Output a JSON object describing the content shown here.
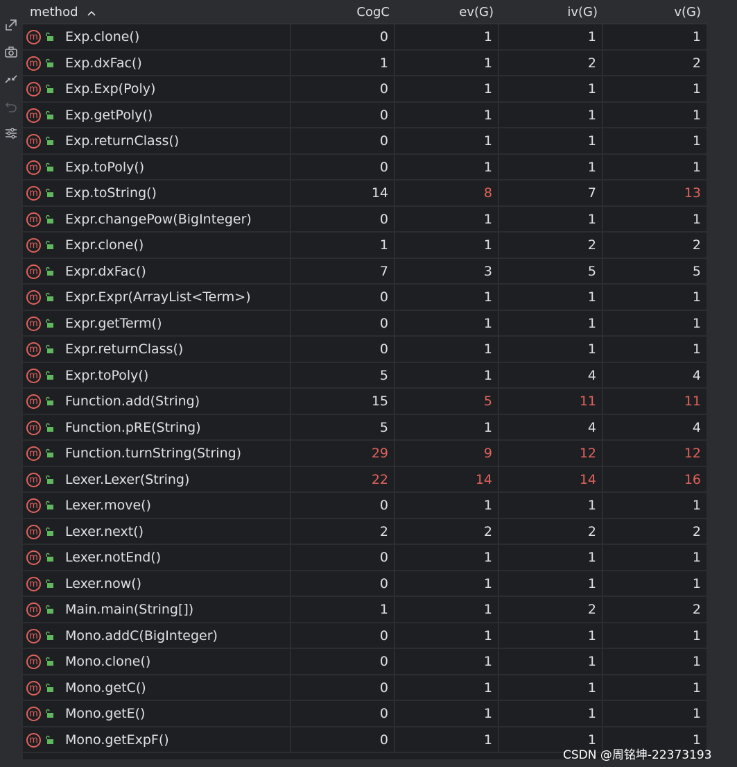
{
  "columns": {
    "method": "method",
    "cogc": "CogC",
    "ev": "ev(G)",
    "iv": "iv(G)",
    "v": "v(G)"
  },
  "toolbar": {
    "icons": [
      "export-icon",
      "camera-icon",
      "collapse-icon",
      "undo-icon",
      "settings-icon"
    ]
  },
  "colors": {
    "warning": "#e0625c",
    "normal": "#dfe1e5",
    "method_icon": "#e0625c",
    "lock_icon": "#5fb85c"
  },
  "rows": [
    {
      "name": "Exp.clone()",
      "cogc": "0",
      "ev": "1",
      "iv": "1",
      "v": "1",
      "red": []
    },
    {
      "name": "Exp.dxFac()",
      "cogc": "1",
      "ev": "1",
      "iv": "2",
      "v": "2",
      "red": []
    },
    {
      "name": "Exp.Exp(Poly)",
      "cogc": "0",
      "ev": "1",
      "iv": "1",
      "v": "1",
      "red": []
    },
    {
      "name": "Exp.getPoly()",
      "cogc": "0",
      "ev": "1",
      "iv": "1",
      "v": "1",
      "red": []
    },
    {
      "name": "Exp.returnClass()",
      "cogc": "0",
      "ev": "1",
      "iv": "1",
      "v": "1",
      "red": []
    },
    {
      "name": "Exp.toPoly()",
      "cogc": "0",
      "ev": "1",
      "iv": "1",
      "v": "1",
      "red": []
    },
    {
      "name": "Exp.toString()",
      "cogc": "14",
      "ev": "8",
      "iv": "7",
      "v": "13",
      "red": [
        "ev",
        "v"
      ]
    },
    {
      "name": "Expr.changePow(BigInteger)",
      "cogc": "0",
      "ev": "1",
      "iv": "1",
      "v": "1",
      "red": []
    },
    {
      "name": "Expr.clone()",
      "cogc": "1",
      "ev": "1",
      "iv": "2",
      "v": "2",
      "red": []
    },
    {
      "name": "Expr.dxFac()",
      "cogc": "7",
      "ev": "3",
      "iv": "5",
      "v": "5",
      "red": []
    },
    {
      "name": "Expr.Expr(ArrayList<Term>)",
      "cogc": "0",
      "ev": "1",
      "iv": "1",
      "v": "1",
      "red": []
    },
    {
      "name": "Expr.getTerm()",
      "cogc": "0",
      "ev": "1",
      "iv": "1",
      "v": "1",
      "red": []
    },
    {
      "name": "Expr.returnClass()",
      "cogc": "0",
      "ev": "1",
      "iv": "1",
      "v": "1",
      "red": []
    },
    {
      "name": "Expr.toPoly()",
      "cogc": "5",
      "ev": "1",
      "iv": "4",
      "v": "4",
      "red": []
    },
    {
      "name": "Function.add(String)",
      "cogc": "15",
      "ev": "5",
      "iv": "11",
      "v": "11",
      "red": [
        "ev",
        "iv",
        "v"
      ]
    },
    {
      "name": "Function.pRE(String)",
      "cogc": "5",
      "ev": "1",
      "iv": "4",
      "v": "4",
      "red": []
    },
    {
      "name": "Function.turnString(String)",
      "cogc": "29",
      "ev": "9",
      "iv": "12",
      "v": "12",
      "red": [
        "cogc",
        "ev",
        "iv",
        "v"
      ]
    },
    {
      "name": "Lexer.Lexer(String)",
      "cogc": "22",
      "ev": "14",
      "iv": "14",
      "v": "16",
      "red": [
        "cogc",
        "ev",
        "iv",
        "v"
      ]
    },
    {
      "name": "Lexer.move()",
      "cogc": "0",
      "ev": "1",
      "iv": "1",
      "v": "1",
      "red": []
    },
    {
      "name": "Lexer.next()",
      "cogc": "2",
      "ev": "2",
      "iv": "2",
      "v": "2",
      "red": []
    },
    {
      "name": "Lexer.notEnd()",
      "cogc": "0",
      "ev": "1",
      "iv": "1",
      "v": "1",
      "red": []
    },
    {
      "name": "Lexer.now()",
      "cogc": "0",
      "ev": "1",
      "iv": "1",
      "v": "1",
      "red": []
    },
    {
      "name": "Main.main(String[])",
      "cogc": "1",
      "ev": "1",
      "iv": "2",
      "v": "2",
      "red": []
    },
    {
      "name": "Mono.addC(BigInteger)",
      "cogc": "0",
      "ev": "1",
      "iv": "1",
      "v": "1",
      "red": []
    },
    {
      "name": "Mono.clone()",
      "cogc": "0",
      "ev": "1",
      "iv": "1",
      "v": "1",
      "red": []
    },
    {
      "name": "Mono.getC()",
      "cogc": "0",
      "ev": "1",
      "iv": "1",
      "v": "1",
      "red": []
    },
    {
      "name": "Mono.getE()",
      "cogc": "0",
      "ev": "1",
      "iv": "1",
      "v": "1",
      "red": []
    },
    {
      "name": "Mono.getExpF()",
      "cogc": "0",
      "ev": "1",
      "iv": "1",
      "v": "1",
      "red": []
    }
  ],
  "method_icon_letter": "m",
  "watermark": "CSDN @周铭坤-22373193"
}
